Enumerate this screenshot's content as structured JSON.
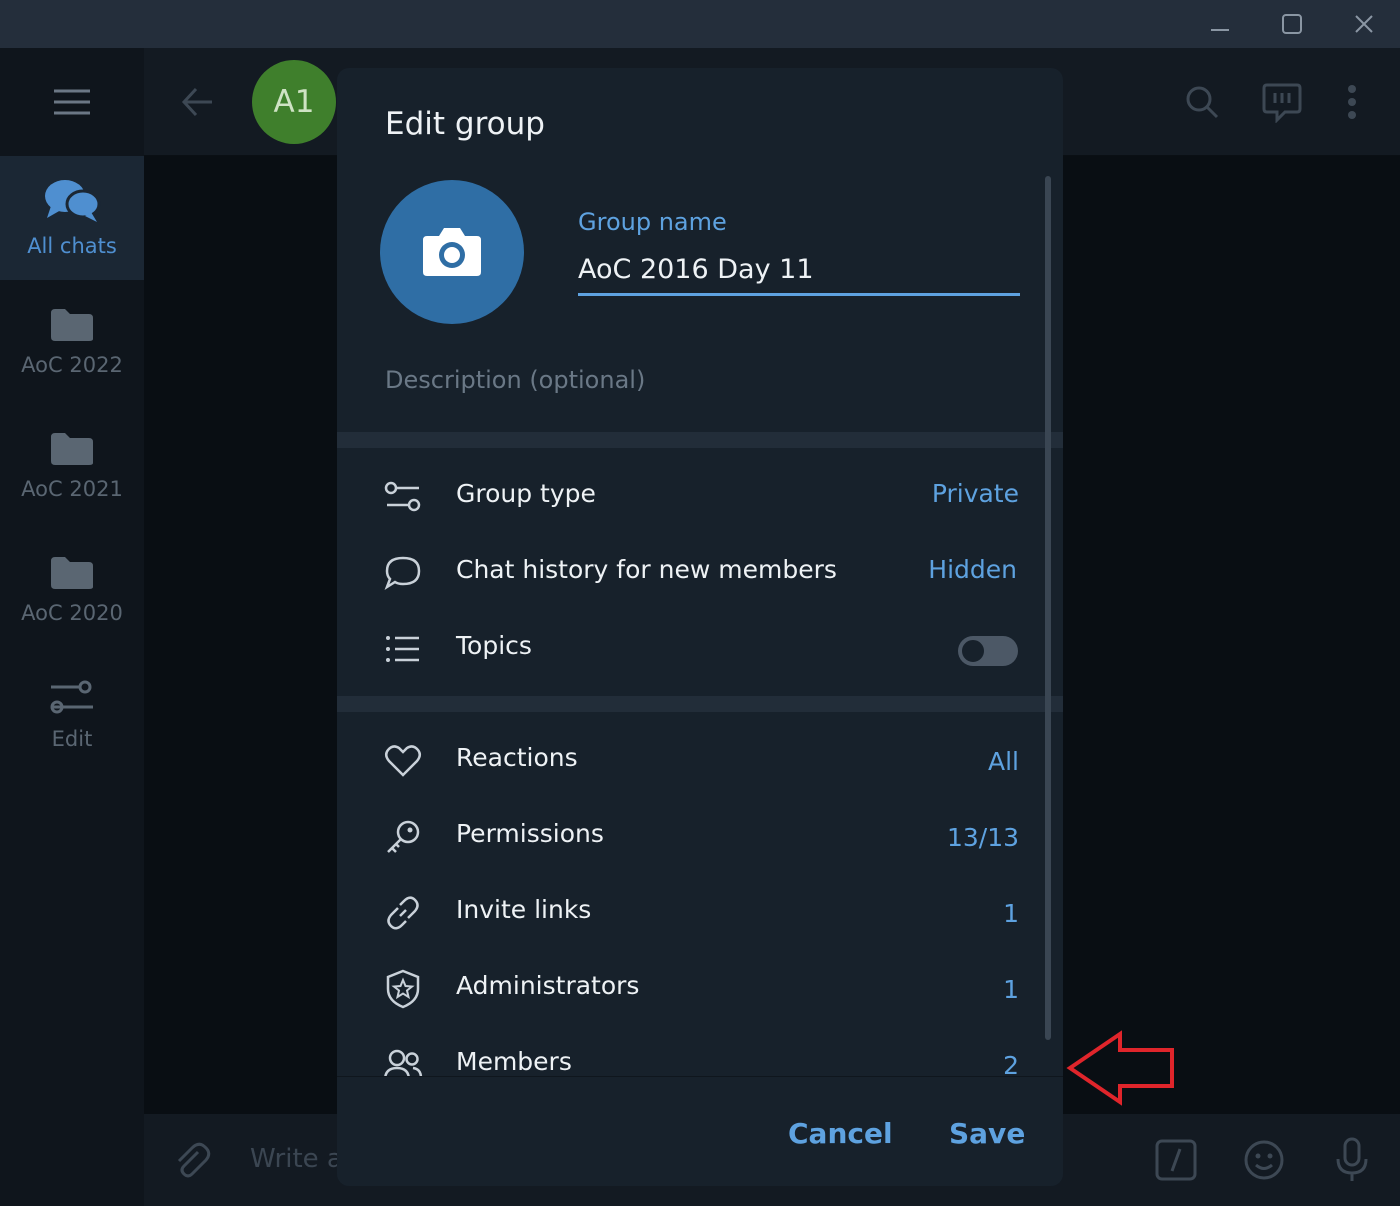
{
  "window": {
    "controls": [
      "minimize-icon",
      "maximize-icon",
      "close-icon"
    ]
  },
  "sidebar": {
    "folders": [
      {
        "label": "All chats",
        "icon": "chat-bubbles-icon",
        "active": true
      },
      {
        "label": "AoC 2022",
        "icon": "folder-icon"
      },
      {
        "label": "AoC 2021",
        "icon": "folder-icon"
      },
      {
        "label": "AoC 2020",
        "icon": "folder-icon"
      },
      {
        "label": "Edit",
        "icon": "sliders-icon"
      }
    ]
  },
  "chat": {
    "avatar_initials": "A1",
    "composer_placeholder": "Write a"
  },
  "modal": {
    "title": "Edit group",
    "group_name_label": "Group name",
    "group_name_value": "AoC 2016 Day 11",
    "description_placeholder": "Description (optional)",
    "section1": [
      {
        "label": "Group type",
        "value": "Private",
        "icon": "settings-toggle-icon"
      },
      {
        "label": "Chat history for new members",
        "value": "Hidden",
        "icon": "chat-bubble-icon"
      },
      {
        "label": "Topics",
        "icon": "list-icon",
        "toggle": false
      }
    ],
    "section2": [
      {
        "label": "Reactions",
        "value": "All",
        "icon": "heart-icon"
      },
      {
        "label": "Permissions",
        "value": "13/13",
        "icon": "key-icon"
      },
      {
        "label": "Invite links",
        "value": "1",
        "icon": "link-icon"
      },
      {
        "label": "Administrators",
        "value": "1",
        "icon": "shield-star-icon"
      },
      {
        "label": "Members",
        "value": "2",
        "icon": "members-icon"
      }
    ],
    "cancel_label": "Cancel",
    "save_label": "Save"
  },
  "colors": {
    "accent": "#5ea2e0",
    "annotation_arrow": "#e0252b"
  }
}
